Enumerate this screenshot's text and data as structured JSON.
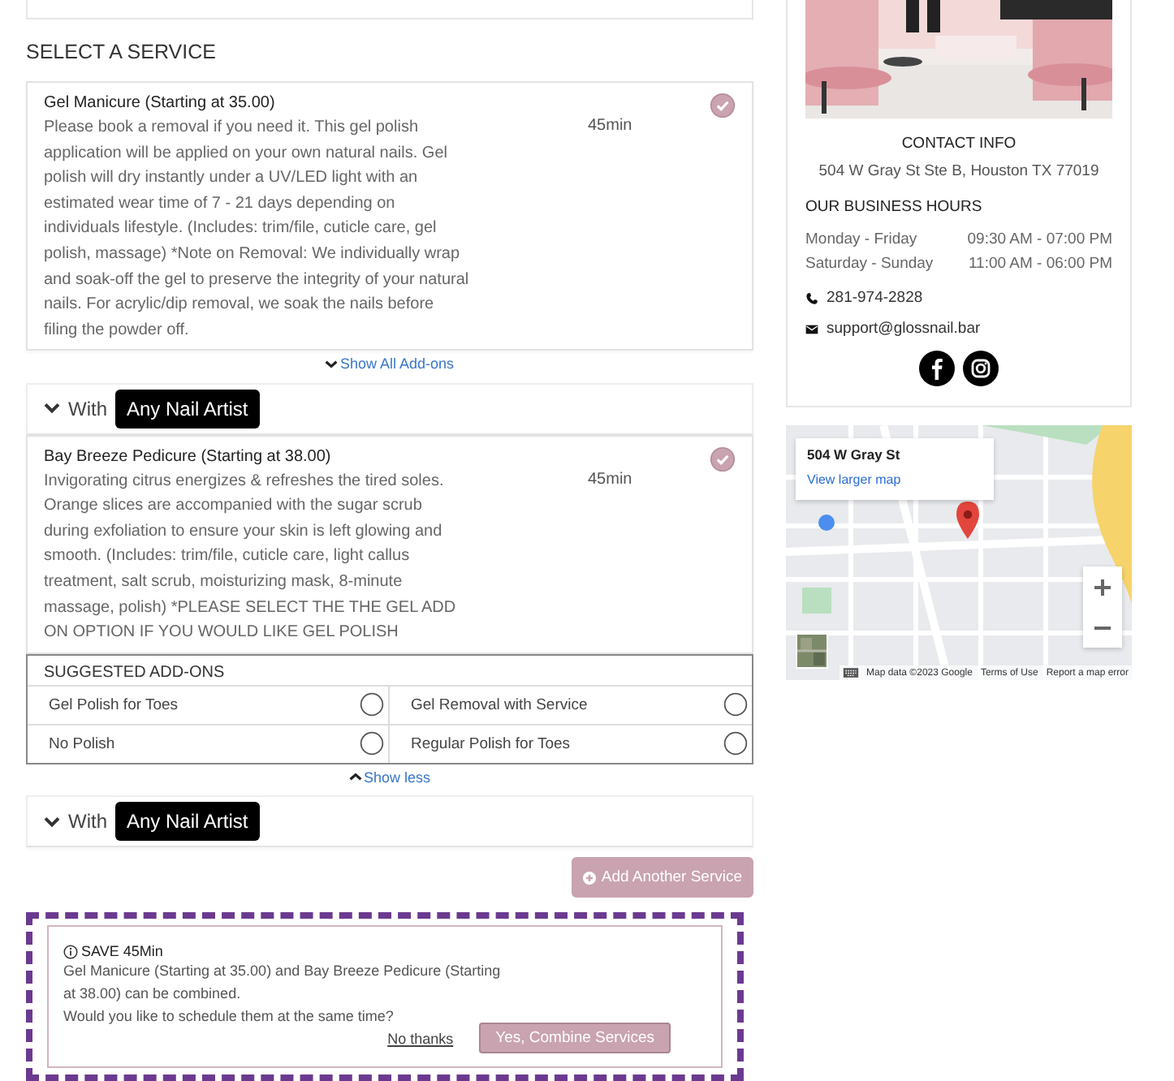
{
  "section_title": "SELECT A SERVICE",
  "services": [
    {
      "name": "Gel Manicure (Starting at 35.00)",
      "description": "Please book a removal if you need it. This gel polish application will be applied on your own natural nails. Gel polish will dry instantly under a UV/LED light with an estimated wear time of 7 - 21 days depending on individuals lifestyle. (Includes: trim/file, cuticle care, gel polish, massage) *Note on Removal: We individually wrap and soak-off the gel to preserve the integrity of your natural nails. For acrylic/dip removal, we soak the nails before filing the powder off.",
      "duration": "45min",
      "selected": true,
      "addons_expanded": false,
      "addons_toggle": "Show All Add-ons",
      "artist_prefix": "With",
      "artist": "Any Nail Artist"
    },
    {
      "name": "Bay Breeze Pedicure (Starting at 38.00)",
      "description": "Invigorating citrus energizes & refreshes the tired soles. Orange slices are accompanied with the sugar scrub during exfoliation to ensure your skin is left glowing and smooth. (Includes: trim/file, cuticle care, light callus treatment, salt scrub, moisturizing mask, 8-minute massage, polish) *PLEASE SELECT THE THE GEL ADD ON OPTION IF YOU WOULD LIKE GEL POLISH",
      "duration": "45min",
      "selected": true,
      "addons_expanded": true,
      "addons_title": "SUGGESTED ADD-ONS",
      "addons": [
        {
          "name": "Gel Polish for Toes",
          "checked": false
        },
        {
          "name": "Gel Removal with Service",
          "checked": false
        },
        {
          "name": "No Polish",
          "checked": false
        },
        {
          "name": "Regular Polish for Toes",
          "checked": false
        }
      ],
      "addons_toggle": "Show less",
      "artist_prefix": "With",
      "artist": "Any Nail Artist"
    }
  ],
  "add_service_button": "Add Another Service",
  "combine_prompt": {
    "title": "SAVE 45Min",
    "message": "Gel Manicure (Starting at 35.00) and Bay Breeze Pedicure (Starting at 38.00) can be combined.",
    "question": "Would you like to schedule them at the same time?",
    "decline": "No thanks",
    "accept": "Yes, Combine Services"
  },
  "sidebar": {
    "contact_heading": "CONTACT INFO",
    "address": "504 W Gray St Ste B, Houston TX 77019",
    "hours_heading": "OUR BUSINESS HOURS",
    "hours": [
      {
        "days": "Monday - Friday",
        "time": "09:30 AM - 07:00 PM"
      },
      {
        "days": "Saturday - Sunday",
        "time": "11:00 AM - 06:00 PM"
      }
    ],
    "phone": "281-974-2828",
    "email": "support@glossnail.bar",
    "social": [
      {
        "kind": "facebook"
      },
      {
        "kind": "instagram"
      }
    ]
  },
  "map": {
    "place": "504 W Gray St",
    "link": "View larger map",
    "attribution": "Map data ©2023 Google",
    "terms": "Terms of Use",
    "report": "Report a map error"
  }
}
